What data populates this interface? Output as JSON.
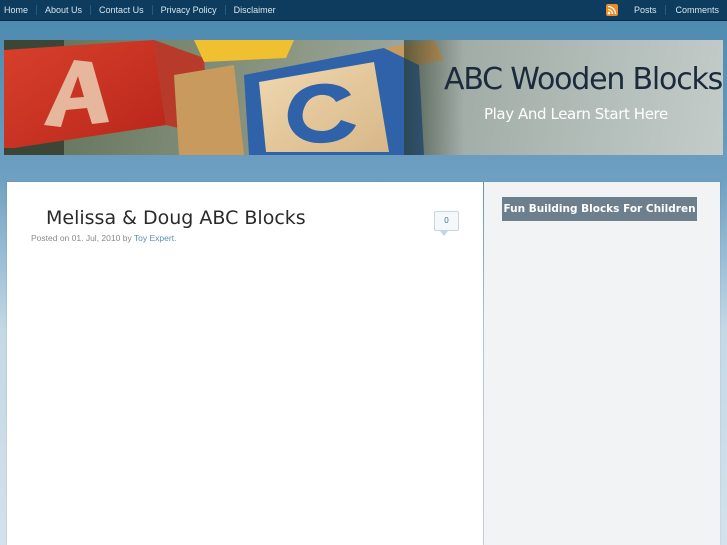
{
  "nav": {
    "items": [
      {
        "label": "Home"
      },
      {
        "label": "About Us"
      },
      {
        "label": "Contact Us"
      },
      {
        "label": "Privacy Policy"
      },
      {
        "label": "Disclaimer"
      }
    ],
    "feeds": {
      "posts_label": "Posts",
      "comments_label": "Comments",
      "rss_icon": "rss-feed-icon"
    }
  },
  "header": {
    "site_title": "ABC Wooden Blocks",
    "tagline": "Play And Learn Start Here",
    "banner_image": "wooden-abc-blocks-photo"
  },
  "post": {
    "title": "Melissa & Doug ABC Blocks",
    "meta": {
      "posted_on_label": "Posted on",
      "date": "01. Jul, 2010",
      "by_label": "by",
      "author": "Toy Expert."
    },
    "comment_count": "0"
  },
  "sidebar": {
    "widget_title": "Fun Building Blocks For Children"
  },
  "colors": {
    "topbar_bg": "#0d3c5e",
    "page_gradient_top": "#4a87ad",
    "widget_title_bg": "#6d7f8c",
    "link_color": "#5b8fb5",
    "rss_orange": "#f08a24"
  }
}
